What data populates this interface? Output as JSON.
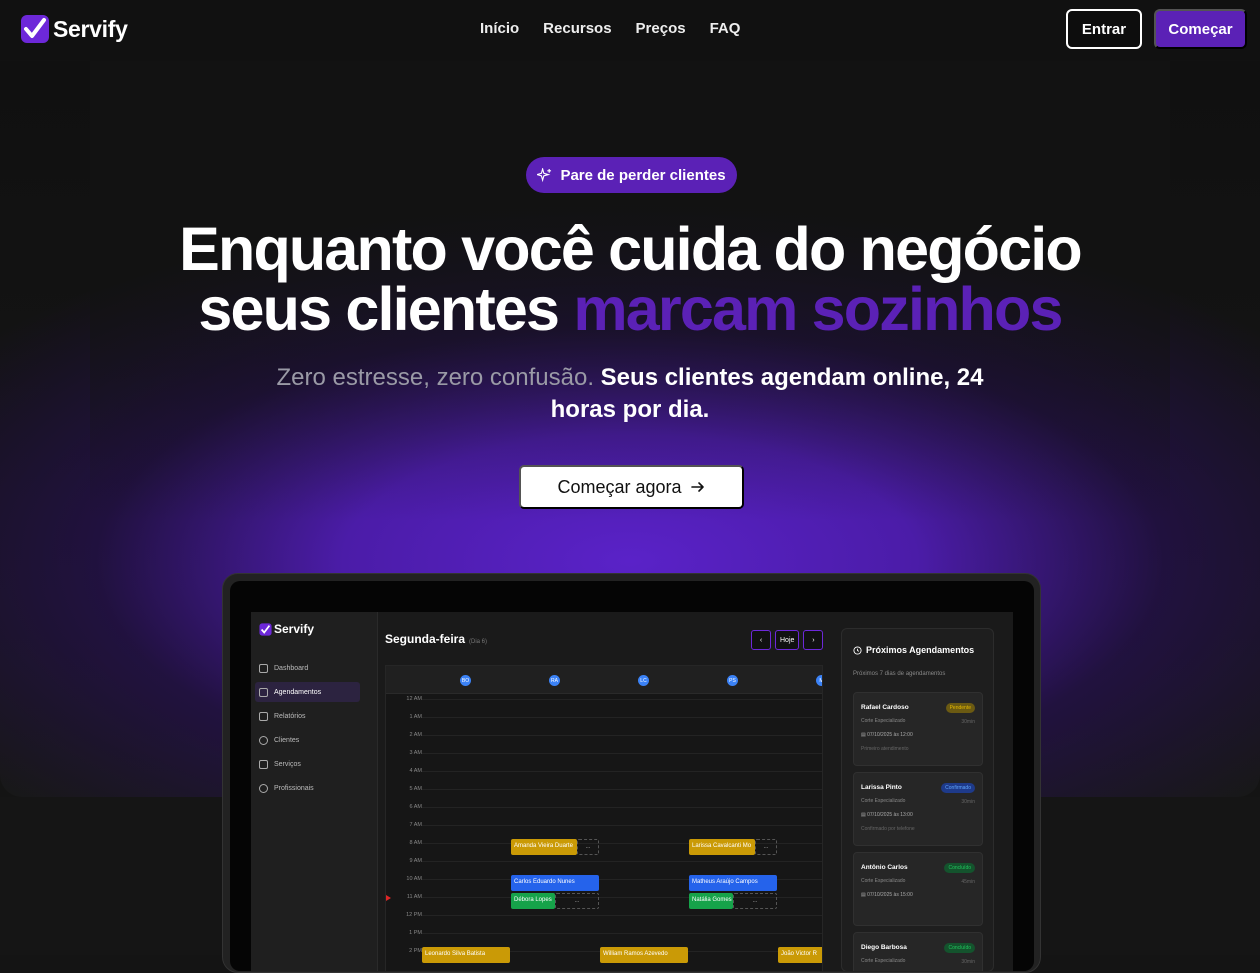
{
  "nav": {
    "brand": "Servify",
    "links": [
      "Início",
      "Recursos",
      "Preços",
      "FAQ"
    ],
    "login": "Entrar",
    "signup": "Começar"
  },
  "hero": {
    "badge": "Pare de perder clientes",
    "title_line1": "Enquanto você cuida do negócio",
    "title_line2_plain": "seus clientes",
    "title_line2_accent": "marcam sozinhos",
    "subtitle_muted": "Zero estresse, zero confusão.",
    "subtitle_strong": "Seus clientes agendam online, 24 horas por dia.",
    "cta": "Começar agora"
  },
  "colors": {
    "accent": "#5b21b6",
    "background": "#141414"
  },
  "app": {
    "brand": "Servify",
    "sidebar": [
      "Dashboard",
      "Agendamentos",
      "Relatórios",
      "Clientes",
      "Serviços",
      "Profissionais"
    ],
    "active_item": "Agendamentos",
    "day_title": "Segunda-feira",
    "day_tag": "(Dia 6)",
    "prev": "‹",
    "today": "Hoje",
    "next": "›",
    "staff": [
      "BO",
      "RA",
      "LC",
      "PS",
      "M"
    ],
    "hours": [
      "12 AM",
      "1 AM",
      "2 AM",
      "3 AM",
      "4 AM",
      "5 AM",
      "6 AM",
      "7 AM",
      "8 AM",
      "9 AM",
      "10 AM",
      "11 AM",
      "12 PM",
      "1 PM",
      "2 PM"
    ],
    "events": [
      {
        "label": "Amanda Vieira Duarte",
        "color": "yellow"
      },
      {
        "label": "Larissa Cavalcanti Mo",
        "color": "yellow"
      },
      {
        "label": "Carlos Eduardo Nunes",
        "color": "blue"
      },
      {
        "label": "Matheus Araújo Campos",
        "color": "blue"
      },
      {
        "label": "Débora Lopes",
        "color": "green"
      },
      {
        "label": "Natália Gomes",
        "color": "green"
      },
      {
        "label": "Leonardo Silva Batista",
        "color": "yellow"
      },
      {
        "label": "William Ramos Azevedo",
        "color": "yellow"
      },
      {
        "label": "João Victor R",
        "color": "yellow"
      }
    ],
    "empty_slot": "...",
    "upcoming": {
      "title": "Próximos Agendamentos",
      "subtitle": "Próximos 7 dias de agendamentos",
      "items": [
        {
          "name": "Rafael Cardoso",
          "service": "Corte Especializado",
          "status": "Pendente",
          "duration": "30min",
          "date": "07/10/2025 às 12:00",
          "note": "Primeiro atendimento"
        },
        {
          "name": "Larissa Pinto",
          "service": "Corte Especializado",
          "status": "Confirmado",
          "duration": "30min",
          "date": "07/10/2025 às 13:00",
          "note": "Confirmado por telefone"
        },
        {
          "name": "Antônio Carlos",
          "service": "Corte Especializado",
          "status": "Concluído",
          "duration": "45min",
          "date": "07/10/2025 às 15:00",
          "note": ""
        },
        {
          "name": "Diego Barbosa",
          "service": "Corte Especializado",
          "status": "Concluído",
          "duration": "30min",
          "date": "",
          "note": ""
        }
      ]
    }
  }
}
